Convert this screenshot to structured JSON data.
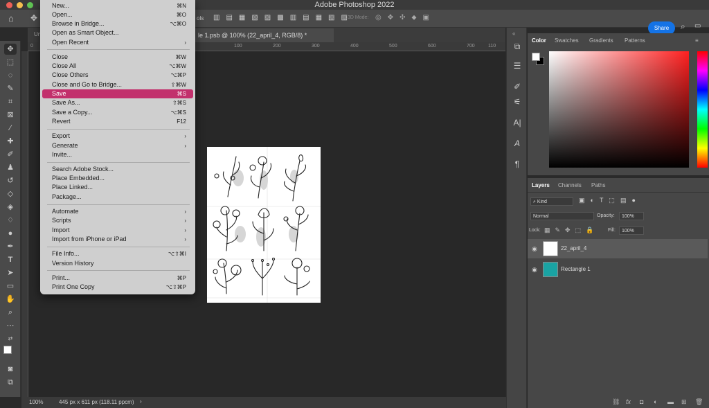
{
  "app_title": "Adobe Photoshop 2022",
  "share_label": "Share",
  "options_text": "ols",
  "mode_3d": "3D Mode:",
  "partial_tab": "Un",
  "document_tab": "le 1.psb @ 100% (22_april_4, RGB/8) *",
  "ruler_ticks": [
    "0",
    "100",
    "200",
    "300",
    "400",
    "500",
    "600",
    "700",
    "800",
    "900",
    "1000",
    "110"
  ],
  "status": {
    "zoom": "100%",
    "dimensions": "445 px x 611 px (118.11 ppcm)",
    "arrow": "›"
  },
  "color_panel": {
    "tabs": [
      "Color",
      "Swatches",
      "Gradients",
      "Patterns"
    ]
  },
  "layers_panel": {
    "tabs": [
      "Layers",
      "Channels",
      "Paths"
    ],
    "filter_kind": "Kind",
    "blend_mode": "Normal",
    "opacity_label": "Opacity:",
    "opacity_value": "100%",
    "lock_label": "Lock:",
    "fill_label": "Fill:",
    "fill_value": "100%",
    "layers": [
      {
        "name": "22_april_4"
      },
      {
        "name": "Rectangle 1"
      }
    ],
    "bottom_icons": [
      "link-icon",
      "fx-icon",
      "mask-icon",
      "adjustment-icon",
      "group-icon",
      "new-layer-icon",
      "trash-icon"
    ],
    "fx_label": "fx"
  },
  "menu": {
    "items": [
      {
        "label": "New...",
        "shortcut": "⌘N"
      },
      {
        "label": "Open...",
        "shortcut": "⌘O"
      },
      {
        "label": "Browse in Bridge...",
        "shortcut": "⌥⌘O"
      },
      {
        "label": "Open as Smart Object...",
        "shortcut": ""
      },
      {
        "label": "Open Recent",
        "shortcut": "›"
      },
      {
        "label": "Close",
        "shortcut": "⌘W"
      },
      {
        "label": "Close All",
        "shortcut": "⌥⌘W"
      },
      {
        "label": "Close Others",
        "shortcut": "⌥⌘P"
      },
      {
        "label": "Close and Go to Bridge...",
        "shortcut": "⇧⌘W"
      },
      {
        "label": "Save",
        "shortcut": "⌘S"
      },
      {
        "label": "Save As...",
        "shortcut": "⇧⌘S"
      },
      {
        "label": "Save a Copy...",
        "shortcut": "⌥⌘S"
      },
      {
        "label": "Revert",
        "shortcut": "F12"
      },
      {
        "label": "Export",
        "shortcut": "›"
      },
      {
        "label": "Generate",
        "shortcut": "›"
      },
      {
        "label": "Invite...",
        "shortcut": ""
      },
      {
        "label": "Search Adobe Stock...",
        "shortcut": ""
      },
      {
        "label": "Place Embedded...",
        "shortcut": ""
      },
      {
        "label": "Place Linked...",
        "shortcut": ""
      },
      {
        "label": "Package...",
        "shortcut": ""
      },
      {
        "label": "Automate",
        "shortcut": "›"
      },
      {
        "label": "Scripts",
        "shortcut": "›"
      },
      {
        "label": "Import",
        "shortcut": "›"
      },
      {
        "label": "Import from iPhone or iPad",
        "shortcut": "›"
      },
      {
        "label": "File Info...",
        "shortcut": "⌥⇧⌘I"
      },
      {
        "label": "Version History",
        "shortcut": ""
      },
      {
        "label": "Print...",
        "shortcut": "⌘P"
      },
      {
        "label": "Print One Copy",
        "shortcut": "⌥⇧⌘P"
      }
    ]
  },
  "colors": {
    "highlight": "#c2306c",
    "share": "#1473e6",
    "layer_thumb": "#1aa3a3"
  }
}
